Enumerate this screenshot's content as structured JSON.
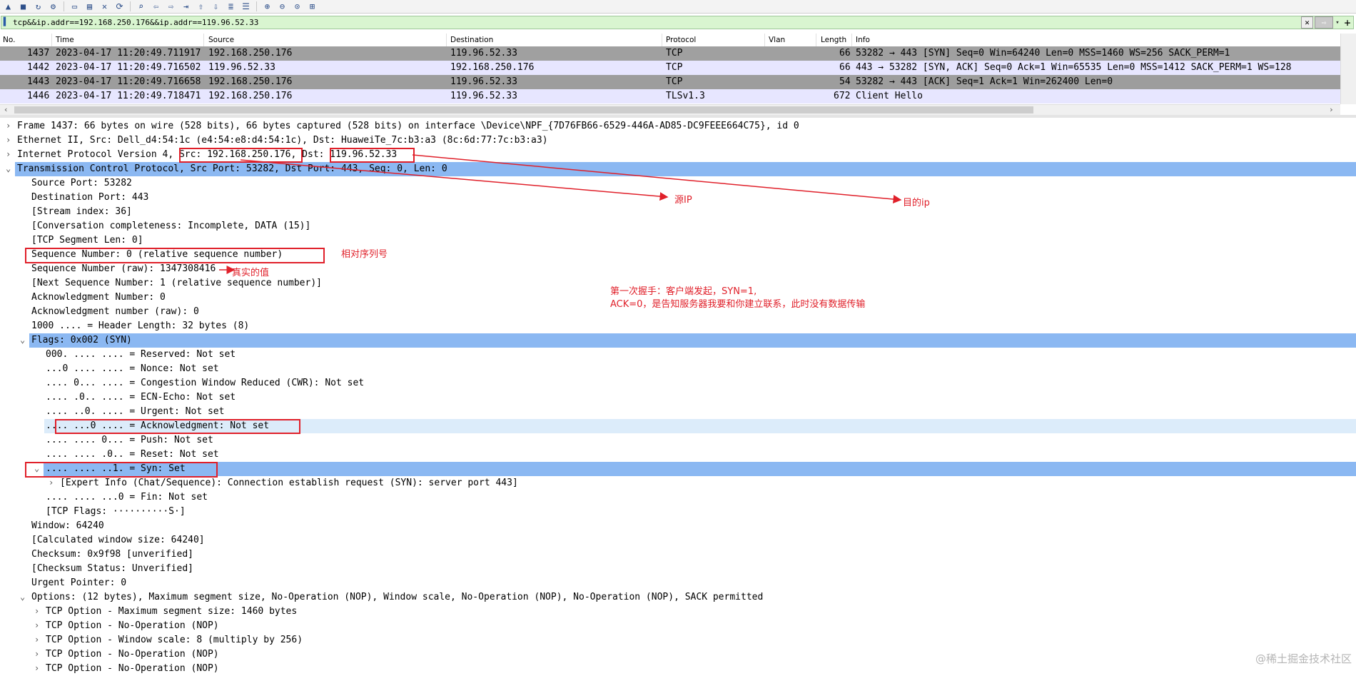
{
  "toolbar": {
    "icons": [
      "shark-fin-icon",
      "stop-icon",
      "restart-icon",
      "options-gear-icon",
      "open-folder-icon",
      "save-icon",
      "close-file-icon",
      "reload-icon",
      "find-icon",
      "back-icon",
      "forward-icon",
      "go-to-packet-icon",
      "first-packet-icon",
      "last-packet-icon",
      "autoscroll-icon",
      "colorize-icon",
      "zoom-in-icon",
      "zoom-out-icon",
      "normal-size-icon",
      "resize-columns-icon"
    ]
  },
  "filter": {
    "value": "tcp&&ip.addr==192.168.250.176&&ip.addr==119.96.52.33"
  },
  "columns": [
    "No.",
    "Time",
    "Source",
    "Destination",
    "Protocol",
    "Vlan",
    "Length",
    "Info"
  ],
  "packets": [
    {
      "no": "1437",
      "time": "2023-04-17 11:20:49.711917",
      "src": "192.168.250.176",
      "dst": "119.96.52.33",
      "proto": "TCP",
      "vlan": "",
      "len": "66",
      "info": "53282 → 443 [SYN] Seq=0 Win=64240 Len=0 MSS=1460 WS=256 SACK_PERM=1"
    },
    {
      "no": "1442",
      "time": "2023-04-17 11:20:49.716502",
      "src": "119.96.52.33",
      "dst": "192.168.250.176",
      "proto": "TCP",
      "vlan": "",
      "len": "66",
      "info": "443 → 53282 [SYN, ACK] Seq=0 Ack=1 Win=65535 Len=0 MSS=1412 SACK_PERM=1 WS=128"
    },
    {
      "no": "1443",
      "time": "2023-04-17 11:20:49.716658",
      "src": "192.168.250.176",
      "dst": "119.96.52.33",
      "proto": "TCP",
      "vlan": "",
      "len": "54",
      "info": "53282 → 443 [ACK] Seq=1 Ack=1 Win=262400 Len=0"
    },
    {
      "no": "1446",
      "time": "2023-04-17 11:20:49.718471",
      "src": "192.168.250.176",
      "dst": "119.96.52.33",
      "proto": "TLSv1.3",
      "vlan": "",
      "len": "672",
      "info": "Client Hello"
    }
  ],
  "details": [
    {
      "arrow": "›",
      "text": "Frame 1437: 66 bytes on wire (528 bits), 66 bytes captured (528 bits) on interface \\Device\\NPF_{7D76FB66-6529-446A-AD85-DC9FEEE664C75}, id 0"
    },
    {
      "arrow": "›",
      "text": "Ethernet II, Src: Dell_d4:54:1c (e4:54:e8:d4:54:1c), Dst: HuaweiTe_7c:b3:a3 (8c:6d:77:7c:b3:a3)"
    },
    {
      "arrow": "›",
      "text": "Internet Protocol Version 4, Src: 192.168.250.176, Dst: 119.96.52.33"
    },
    {
      "arrow": "⌄",
      "text": "Transmission Control Protocol, Src Port: 53282, Dst Port: 443, Seq: 0, Len: 0"
    },
    {
      "arrow": "",
      "text": "Source Port: 53282"
    },
    {
      "arrow": "",
      "text": "Destination Port: 443"
    },
    {
      "arrow": "",
      "text": "[Stream index: 36]"
    },
    {
      "arrow": "",
      "text": "[Conversation completeness: Incomplete, DATA (15)]"
    },
    {
      "arrow": "",
      "text": "[TCP Segment Len: 0]"
    },
    {
      "arrow": "",
      "text": "Sequence Number: 0    (relative sequence number)"
    },
    {
      "arrow": "",
      "text": "Sequence Number (raw): 1347308416"
    },
    {
      "arrow": "",
      "text": "[Next Sequence Number: 1    (relative sequence number)]"
    },
    {
      "arrow": "",
      "text": "Acknowledgment Number: 0"
    },
    {
      "arrow": "",
      "text": "Acknowledgment number (raw): 0"
    },
    {
      "arrow": "",
      "text": "1000 .... = Header Length: 32 bytes (8)"
    },
    {
      "arrow": "⌄",
      "text": "Flags: 0x002 (SYN)"
    },
    {
      "arrow": "",
      "text": "000. .... .... = Reserved: Not set"
    },
    {
      "arrow": "",
      "text": "...0 .... .... = Nonce: Not set"
    },
    {
      "arrow": "",
      "text": ".... 0... .... = Congestion Window Reduced (CWR): Not set"
    },
    {
      "arrow": "",
      "text": ".... .0.. .... = ECN-Echo: Not set"
    },
    {
      "arrow": "",
      "text": ".... ..0. .... = Urgent: Not set"
    },
    {
      "arrow": "",
      "text": ".... ...0 .... = Acknowledgment: Not set"
    },
    {
      "arrow": "",
      "text": ".... .... 0... = Push: Not set"
    },
    {
      "arrow": "",
      "text": ".... .... .0.. = Reset: Not set"
    },
    {
      "arrow": "⌄",
      "text": ".... .... ..1. = Syn: Set"
    },
    {
      "arrow": "›",
      "text": "[Expert Info (Chat/Sequence): Connection establish request (SYN): server port 443]"
    },
    {
      "arrow": "",
      "text": ".... .... ...0 = Fin: Not set"
    },
    {
      "arrow": "",
      "text": "[TCP Flags: ··········S·]"
    },
    {
      "arrow": "",
      "text": "Window: 64240"
    },
    {
      "arrow": "",
      "text": "[Calculated window size: 64240]"
    },
    {
      "arrow": "",
      "text": "Checksum: 0x9f98 [unverified]"
    },
    {
      "arrow": "",
      "text": "[Checksum Status: Unverified]"
    },
    {
      "arrow": "",
      "text": "Urgent Pointer: 0"
    },
    {
      "arrow": "⌄",
      "text": "Options: (12 bytes), Maximum segment size, No-Operation (NOP), Window scale, No-Operation (NOP), No-Operation (NOP), SACK permitted"
    },
    {
      "arrow": "›",
      "text": "TCP Option - Maximum segment size: 1460 bytes"
    },
    {
      "arrow": "›",
      "text": "TCP Option - No-Operation (NOP)"
    },
    {
      "arrow": "›",
      "text": "TCP Option - Window scale: 8 (multiply by 256)"
    },
    {
      "arrow": "›",
      "text": "TCP Option - No-Operation (NOP)"
    },
    {
      "arrow": "›",
      "text": "TCP Option - No-Operation (NOP)"
    }
  ],
  "annotations": {
    "src_ip": "源IP",
    "dst_ip": "目的ip",
    "relative_seq": "相对序列号",
    "real_value": "真实的值",
    "handshake_line1": "第一次握手：客户端发起，SYN=1,",
    "handshake_line2": "ACK=0，是告知服务器我要和你建立联系，此时没有数据传输"
  },
  "watermark": "@稀土掘金技术社区",
  "colors": {
    "annotation": "#e0202a",
    "selected": "#8bb8f2",
    "filter_bg": "#d9f5d0",
    "syn_row": "#a0a0a0",
    "lavender_row": "#e7e6ff"
  }
}
